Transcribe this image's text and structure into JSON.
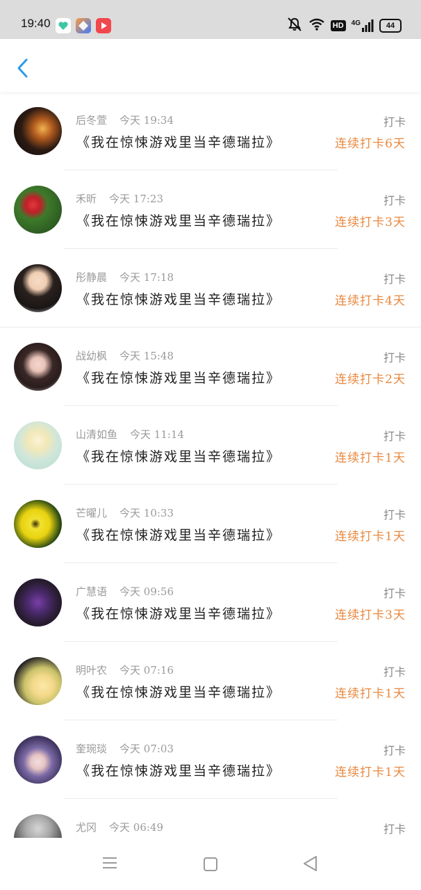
{
  "status_bar": {
    "time": "19:40",
    "battery": "44",
    "network": "4G",
    "hd": "HD",
    "icons": [
      "notifications-mute-icon",
      "wifi-icon",
      "hd-icon",
      "4g-signal-icon",
      "battery-icon"
    ]
  },
  "header": {
    "back_icon": "chevron-left-icon"
  },
  "checkins": [
    {
      "name": "后冬萱",
      "time": "今天 19:34",
      "label": "打卡",
      "book": "《我在惊悚游戏里当辛德瑞拉》",
      "streak": "连续打卡6天",
      "avatar": "sunset-photo"
    },
    {
      "name": "禾昕",
      "time": "今天 17:23",
      "label": "打卡",
      "book": "《我在惊悚游戏里当辛德瑞拉》",
      "streak": "连续打卡3天",
      "avatar": "strawberries-photo"
    },
    {
      "name": "彤静晨",
      "time": "今天 17:18",
      "label": "打卡",
      "book": "《我在惊悚游戏里当辛德瑞拉》",
      "streak": "连续打卡4天",
      "avatar": "girl-photo"
    },
    {
      "name": "战幼枫",
      "time": "今天 15:48",
      "label": "打卡",
      "book": "《我在惊悚游戏里当辛德瑞拉》",
      "streak": "连续打卡2天",
      "avatar": "girl-bob-photo"
    },
    {
      "name": "山清如鱼",
      "time": "今天 11:14",
      "label": "打卡",
      "book": "《我在惊悚游戏里当辛德瑞拉》",
      "streak": "连续打卡1天",
      "avatar": "anime-girl"
    },
    {
      "name": "芒曜儿",
      "time": "今天 10:33",
      "label": "打卡",
      "book": "《我在惊悚游戏里当辛德瑞拉》",
      "streak": "连续打卡1天",
      "avatar": "yellow-flower-photo"
    },
    {
      "name": "广慧语",
      "time": "今天 09:56",
      "label": "打卡",
      "book": "《我在惊悚游戏里当辛德瑞拉》",
      "streak": "连续打卡3天",
      "avatar": "anime-dark"
    },
    {
      "name": "明叶农",
      "time": "今天 07:16",
      "label": "打卡",
      "book": "《我在惊悚游戏里当辛德瑞拉》",
      "streak": "连续打卡1天",
      "avatar": "anime-blonde"
    },
    {
      "name": "奎琬琰",
      "time": "今天 07:03",
      "label": "打卡",
      "book": "《我在惊悚游戏里当辛德瑞拉》",
      "streak": "连续打卡1天",
      "avatar": "anime-ninja"
    },
    {
      "name": "尤冈",
      "time": "今天 06:49",
      "label": "打卡",
      "book": "",
      "streak": "",
      "avatar": "landscape-photo"
    }
  ],
  "nav": {
    "icons": [
      "menu-icon",
      "home-square-icon",
      "back-triangle-icon"
    ]
  },
  "colors": {
    "accent": "#2a9be8",
    "streak": "#e9883e",
    "meta": "#9a9a9a"
  }
}
